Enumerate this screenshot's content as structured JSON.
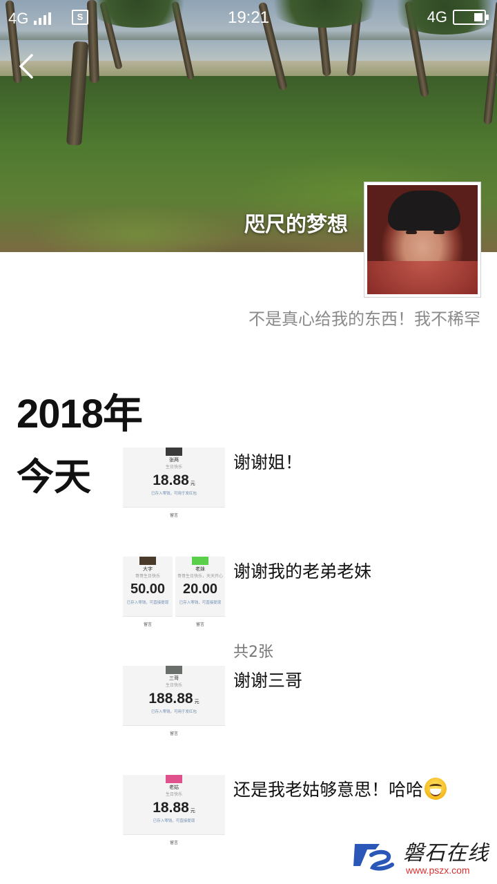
{
  "status_bar": {
    "network_left": "4G",
    "sim_icon": "S",
    "time": "19:21",
    "network_right": "4G",
    "battery_level": 0.3
  },
  "profile": {
    "nickname": "咫尺的梦想",
    "signature": "不是真心给我的东西！我不稀罕"
  },
  "timeline": {
    "year": "2018年",
    "day": "今天",
    "posts": [
      {
        "caption": "谢谢姐！",
        "cards": [
          {
            "name": "张两",
            "wish": "生日快乐",
            "amount": "18.88",
            "unit": "元",
            "note": "已存入零钱，可用于发红包",
            "msg": "留言",
            "avatar_color": "#3a3a3a"
          }
        ]
      },
      {
        "caption": "谢谢我的老弟老妹",
        "count": "共2张",
        "cards": [
          {
            "name": "大字",
            "wish": "哥哥生日快乐",
            "amount": "50.00",
            "unit": "",
            "note": "已存入零钱，可直接提现",
            "msg": "留言",
            "avatar_color": "#4a3a2a"
          },
          {
            "name": "老妹",
            "wish": "哥哥生日快乐，天天开心",
            "amount": "20.00",
            "unit": "",
            "note": "已存入零钱，可直接提现",
            "msg": "留言",
            "avatar_color": "#5ad04a"
          }
        ]
      },
      {
        "caption": "谢谢三哥",
        "cards": [
          {
            "name": "三哥",
            "wish": "生日快乐",
            "amount": "188.88",
            "unit": "元",
            "note": "已存入零钱，可用于发红包",
            "msg": "留言",
            "avatar_color": "#6a6e6a"
          }
        ]
      },
      {
        "caption": "还是我老姑够意思！哈哈",
        "emoji": "grinning-face",
        "cards": [
          {
            "name": "老姑",
            "wish": "生日快乐",
            "amount": "18.88",
            "unit": "元",
            "note": "已存入零钱，可直接提现",
            "msg": "留言",
            "avatar_color": "#e0508a"
          }
        ]
      }
    ]
  },
  "watermark": {
    "name": "磐石在线",
    "url": "www.pszx.com"
  }
}
